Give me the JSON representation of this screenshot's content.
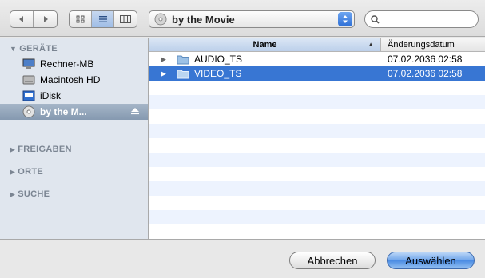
{
  "toolbar": {
    "back_icon": "back-arrow-icon",
    "forward_icon": "forward-arrow-icon",
    "view_modes": [
      "icon-view",
      "list-view",
      "column-view"
    ],
    "active_view": "list-view",
    "location": "by the Movie",
    "search_value": "",
    "search_placeholder": ""
  },
  "sidebar": {
    "sections": {
      "devices": "GERÄTE",
      "shared": "FREIGABEN",
      "places": "ORTE",
      "search": "SUCHE"
    },
    "items": [
      {
        "label": "Rechner-MB",
        "icon": "computer-icon"
      },
      {
        "label": "Macintosh HD",
        "icon": "hard-disk-icon"
      },
      {
        "label": "iDisk",
        "icon": "idisk-icon"
      },
      {
        "label": "by the M...",
        "icon": "dvd-disc-icon",
        "selected": true
      }
    ]
  },
  "list": {
    "columns": {
      "name": "Name",
      "date": "Änderungsdatum"
    },
    "rows": [
      {
        "name": "AUDIO_TS",
        "date": "07.02.2036 02:58"
      },
      {
        "name": "VIDEO_TS",
        "date": "07.02.2036 02:58",
        "selected": true
      }
    ]
  },
  "buttons": {
    "cancel": "Abbrechen",
    "choose": "Auswählen"
  },
  "colors": {
    "selection": "#3876d3",
    "sidebar_bg": "#e0e6ee",
    "sidebar_selected": "#8599b0",
    "default_button": "#4a8be3"
  }
}
